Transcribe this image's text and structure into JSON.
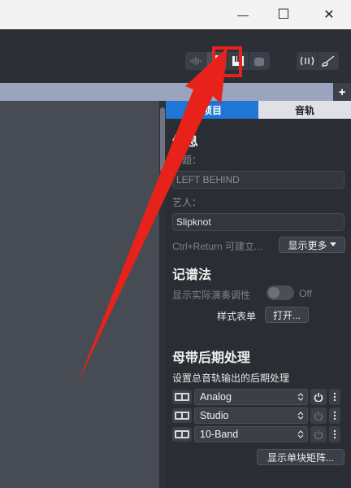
{
  "window": {
    "minimize_glyph": "—",
    "maximize_glyph": "☐",
    "close_glyph": "✕"
  },
  "toolbar": {
    "buttons": [
      "waveform-icon",
      "guitar-icon",
      "piano-icon",
      "drum-icon",
      "metronome-icon",
      "tuner-icon"
    ],
    "highlight_color": "#e8221a"
  },
  "tabstrip": {
    "add_label": "+"
  },
  "panel": {
    "tabs": [
      {
        "label": "项目"
      },
      {
        "label": "音轨"
      }
    ],
    "info": {
      "title": "信息",
      "title_label": "标题：",
      "title_value": "LEFT BEHIND",
      "artist_label": "艺人：",
      "artist_value": "Slipknot",
      "hint": "Ctrl+Return 可建立...",
      "show_more": "显示更多"
    },
    "notation": {
      "title": "记谱法",
      "show_concert_pitch": "显示实际演奏调性",
      "toggle_state": "Off",
      "stylesheet_label": "样式表单",
      "open_button": "打开..."
    },
    "mastering": {
      "title": "母带后期处理",
      "subtitle": "设置总音轨输出的后期处理",
      "effects": [
        {
          "name": "Analog"
        },
        {
          "name": "Studio"
        },
        {
          "name": "10-Band"
        }
      ],
      "matrix_button": "显示单块矩阵..."
    }
  },
  "colors": {
    "accent": "#1f76d4",
    "arrow": "#e8221a"
  }
}
